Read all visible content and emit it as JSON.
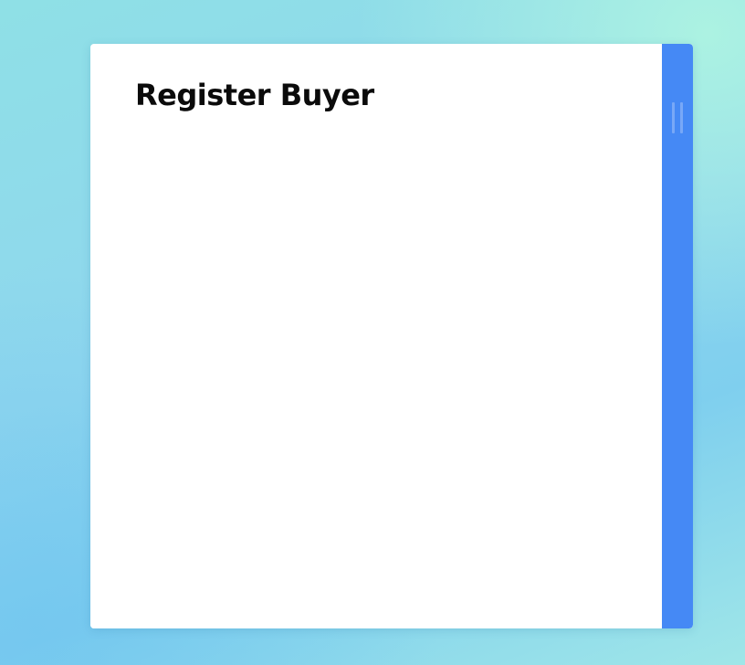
{
  "dialog": {
    "title": "Register Buyer"
  },
  "scrollbar": {
    "color": "#4589f5",
    "thumb_icon": "grip-lines-icon"
  },
  "colors": {
    "background_start": "#8fe0e6",
    "background_end": "#7fcfee",
    "panel": "#ffffff"
  }
}
